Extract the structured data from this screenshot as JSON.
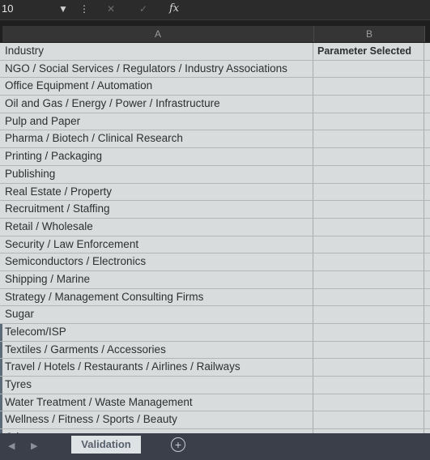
{
  "formula_bar": {
    "name_box": "10",
    "dropdown_icon": "caret-down-icon",
    "more_icon": "vertical-dots-icon",
    "cancel_icon": "close-icon",
    "enter_icon": "check-icon",
    "function_label": "fx"
  },
  "column_headers": {
    "a": "A",
    "b": "B"
  },
  "header": {
    "industry": "Industry",
    "parameter": "Parameter Selected"
  },
  "rows": [
    "NGO / Social Services / Regulators / Industry Associations",
    "Office Equipment / Automation",
    "Oil and Gas / Energy / Power / Infrastructure",
    "Pulp and Paper",
    "Pharma / Biotech / Clinical Research",
    "Printing / Packaging",
    "Publishing",
    "Real Estate / Property",
    "Recruitment / Staffing",
    "Retail / Wholesale",
    "Security / Law Enforcement",
    "Semiconductors / Electronics",
    "Shipping / Marine",
    "Strategy / Management Consulting Firms",
    "Sugar",
    "Telecom/ISP",
    "Textiles / Garments / Accessories",
    "Travel / Hotels / Restaurants / Airlines / Railways",
    "Tyres",
    "Water Treatment / Waste Management",
    "Wellness / Fitness / Sports / Beauty",
    "Other"
  ],
  "sheet_tabs": {
    "active": "Validation"
  },
  "colors": {
    "grid_bg": "#d9dcdc",
    "tab_bar": "#3a3f4a",
    "formula_bar": "#2b2b2b"
  }
}
